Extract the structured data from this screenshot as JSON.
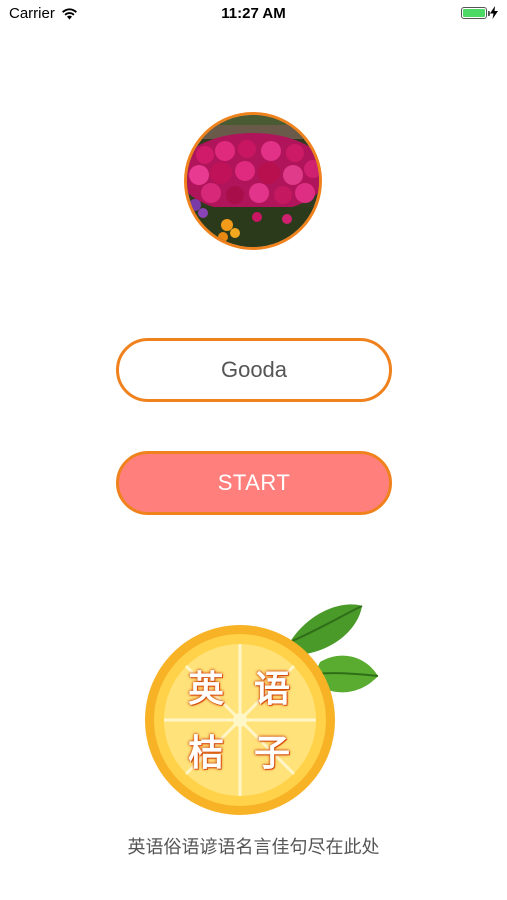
{
  "status_bar": {
    "carrier": "Carrier",
    "time": "11:27 AM",
    "battery_level": 1.0,
    "charging": true
  },
  "avatar": {
    "icon": "flower-photo",
    "border_color": "#f0821e"
  },
  "name_field": {
    "value": "Gooda"
  },
  "start_button": {
    "label": "START",
    "background": "#ff7f7c",
    "border_color": "#f0821e"
  },
  "logo": {
    "chars": [
      "英",
      "语",
      "桔",
      "子"
    ],
    "icon": "orange-logo"
  },
  "tagline": "英语俗语谚语名言佳句尽在此处"
}
